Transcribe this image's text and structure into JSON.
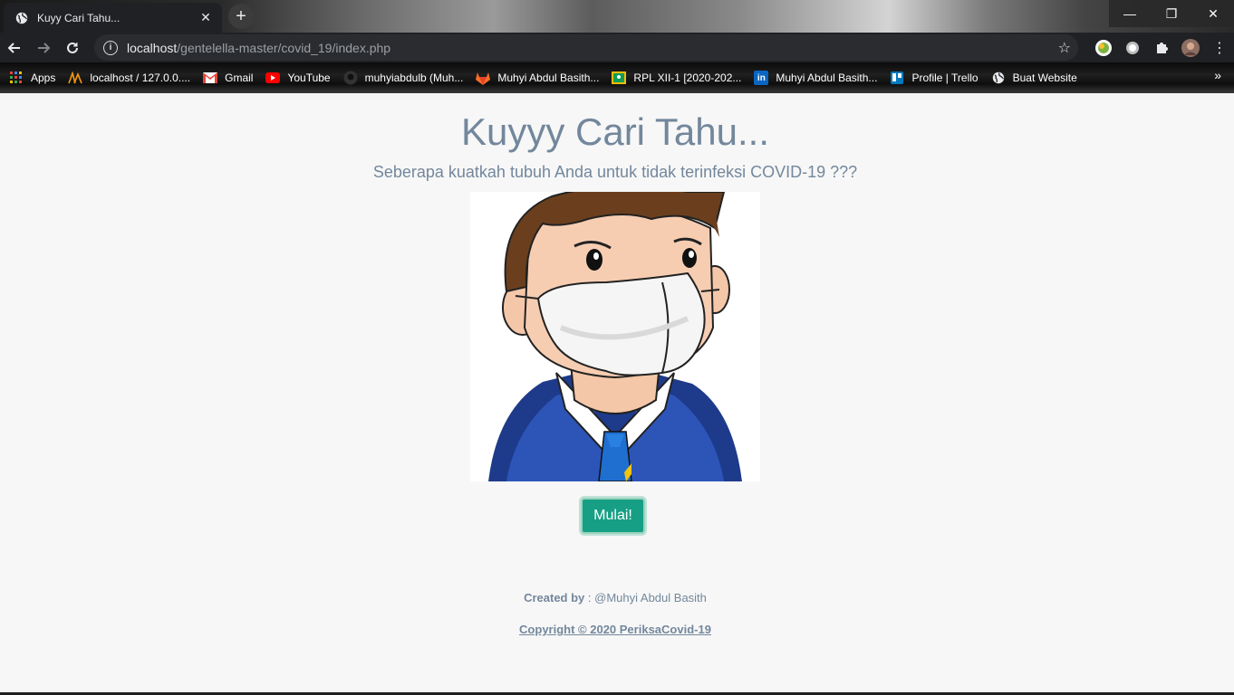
{
  "browser": {
    "tab_title": "Kuyy Cari Tahu...",
    "url_host": "localhost",
    "url_path": "/gentelella-master/covid_19/index.php",
    "bookmarks": [
      {
        "label": "Apps",
        "icon": "apps-grid-icon"
      },
      {
        "label": "localhost / 127.0.0....",
        "icon": "phpmyadmin-icon"
      },
      {
        "label": "Gmail",
        "icon": "gmail-icon"
      },
      {
        "label": "YouTube",
        "icon": "youtube-icon"
      },
      {
        "label": "muhyiabdulb (Muh...",
        "icon": "github-icon"
      },
      {
        "label": "Muhyi Abdul Basith...",
        "icon": "gitlab-icon"
      },
      {
        "label": "RPL XII-1 [2020-202...",
        "icon": "classroom-icon"
      },
      {
        "label": "Muhyi Abdul Basith...",
        "icon": "linkedin-icon"
      },
      {
        "label": "Profile | Trello",
        "icon": "trello-icon"
      },
      {
        "label": "Buat Website",
        "icon": "globe-icon"
      }
    ]
  },
  "page": {
    "heading": "Kuyyy Cari Tahu...",
    "subheading": "Seberapa kuatkah tubuh Anda untuk tidak terinfeksi COVID-19 ???",
    "start_button": "Mulai!",
    "credit_label": "Created by",
    "credit_sep": " : ",
    "credit_name": "@Muhyi Abdul Basith",
    "copyright": "Copyright © 2020 PeriksaCovid-19"
  },
  "colors": {
    "accent": "#169f85",
    "text": "#73879c",
    "background": "#f7f7f7"
  }
}
